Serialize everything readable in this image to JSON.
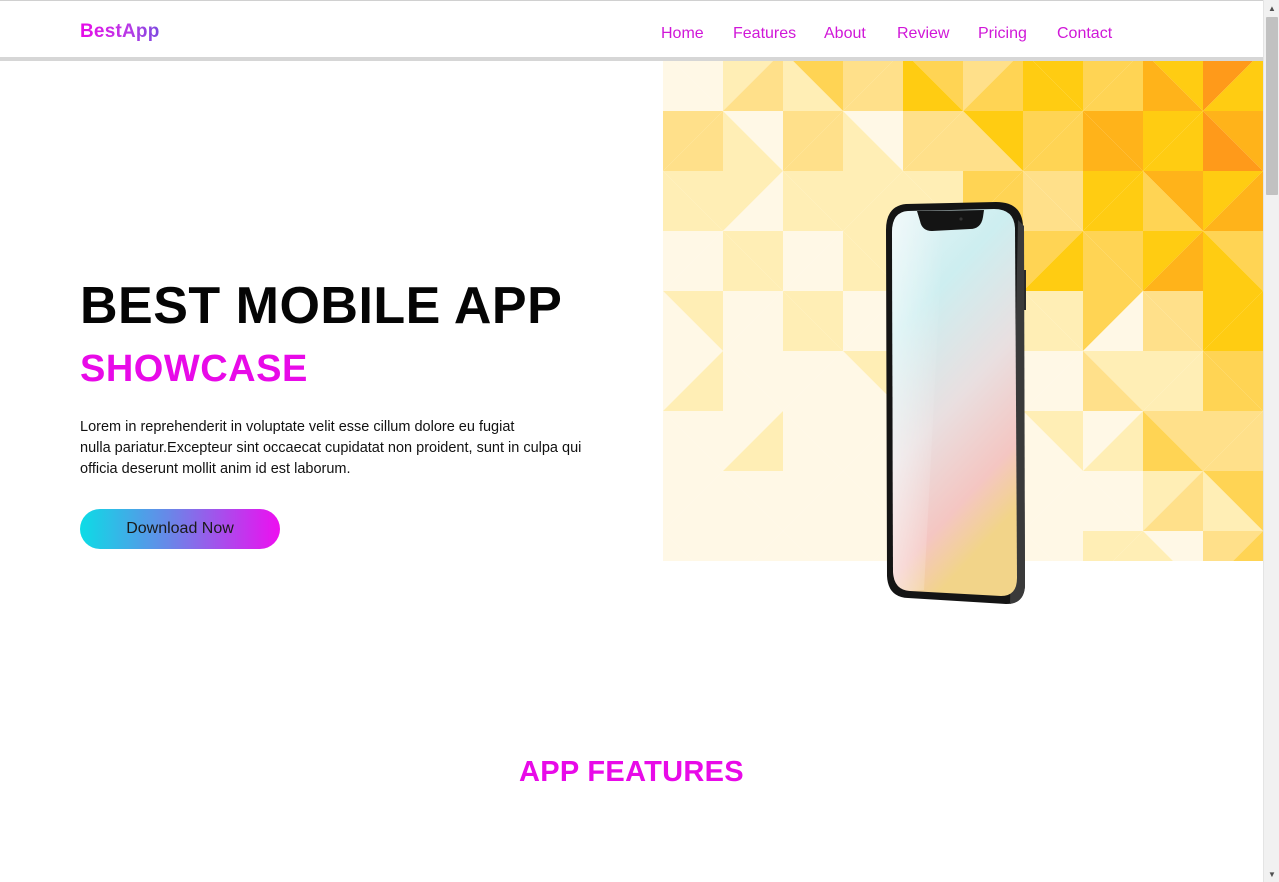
{
  "brand": "BestApp",
  "nav": {
    "items": [
      {
        "label": "Home"
      },
      {
        "label": "Features"
      },
      {
        "label": "About"
      },
      {
        "label": "Review"
      },
      {
        "label": "Pricing"
      },
      {
        "label": "Contact"
      }
    ]
  },
  "hero": {
    "title": "BEST MOBILE APP",
    "subtitle": "SHOWCASE",
    "text_lines": [
      "Lorem in reprehenderit in voluptate velit esse cillum dolore eu fugiat",
      "nulla pariatur.Excepteur sint occaecat cupidatat non proident, sunt in culpa qui",
      "officia deserunt mollit anim id est laborum."
    ],
    "button_label": "Download Now"
  },
  "features": {
    "title": "APP FEATURES"
  },
  "colors": {
    "accent": "#e80ae8",
    "nav_link": "#d017d8",
    "button_start": "#0cdce6",
    "button_end": "#ee0ef0",
    "pattern_yellow": "#ffcc12",
    "pattern_orange": "#ff8c1a"
  },
  "icons": {
    "scroll_up": "triangle-up-icon",
    "scroll_down": "triangle-down-icon"
  }
}
